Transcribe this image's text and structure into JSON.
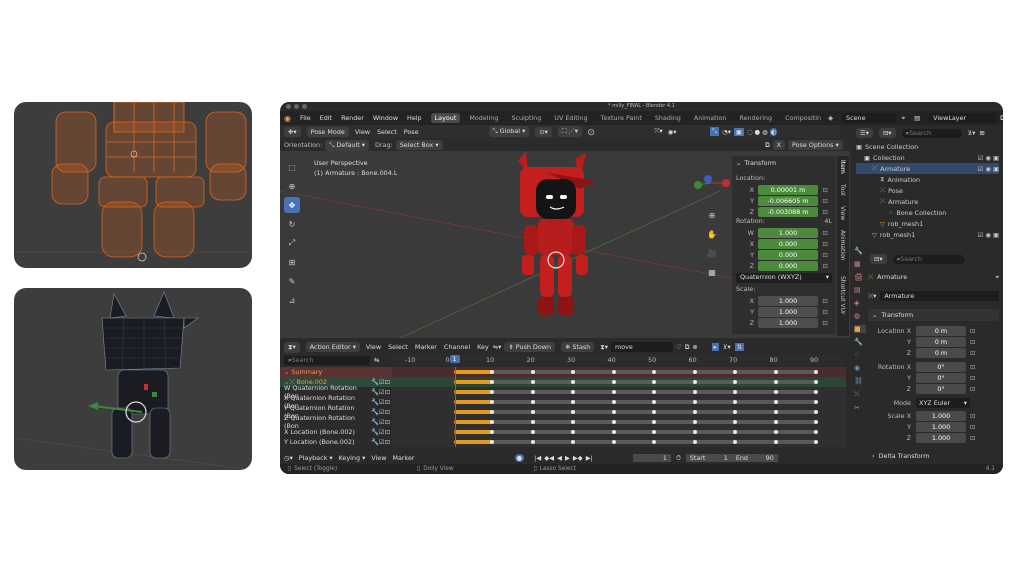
{
  "app": {
    "title": "* milly_FINAL - Blender 4.1",
    "menus": [
      "File",
      "Edit",
      "Render",
      "Window",
      "Help"
    ],
    "workspaces": [
      "Layout",
      "Modeling",
      "Sculpting",
      "UV Editing",
      "Texture Paint",
      "Shading",
      "Animation",
      "Rendering",
      "Compositin"
    ],
    "active_workspace": "Layout",
    "scene": "Scene",
    "view_layer": "ViewLayer"
  },
  "viewport_header": {
    "mode": "Pose Mode",
    "menus": [
      "View",
      "Select",
      "Pose"
    ],
    "transform_orientation": "Global",
    "orientation_label": "Orientation:",
    "orientation_value": "Default",
    "drag_label": "Drag:",
    "drag_value": "Select Box",
    "pose_options": "Pose Options",
    "x_toggle": "X"
  },
  "viewport": {
    "perspective": "User Perspective",
    "active": "(1) Armature : Bone.004.L"
  },
  "npanel": {
    "header": "Transform",
    "location_label": "Location:",
    "location": [
      [
        "X",
        "0.00001 m"
      ],
      [
        "Y",
        "-0.006605 m"
      ],
      [
        "Z",
        "-0.003088 m"
      ]
    ],
    "rotation_label": "Rotation:",
    "rotation_mode_short": "4L",
    "rotation": [
      [
        "W",
        "1.000"
      ],
      [
        "X",
        "0.000"
      ],
      [
        "Y",
        "0.000"
      ],
      [
        "Z",
        "0.000"
      ]
    ],
    "rotation_mode": "Quaternion (WXYZ)",
    "scale_label": "Scale:",
    "scale": [
      [
        "X",
        "1.000"
      ],
      [
        "Y",
        "1.000"
      ],
      [
        "Z",
        "1.000"
      ]
    ],
    "tabs": [
      "Item",
      "Tool",
      "View",
      "Animation",
      "Shortcut VUr"
    ]
  },
  "action_editor": {
    "mode": "Action Editor",
    "menus": [
      "View",
      "Select",
      "Marker",
      "Channel",
      "Key"
    ],
    "push_down": "Push Down",
    "stash": "Stash",
    "action_name": "move",
    "search_placeholder": "Search",
    "ruler": [
      "-10",
      "0",
      "10",
      "20",
      "30",
      "40",
      "50",
      "60",
      "70",
      "80",
      "90"
    ],
    "current_frame_marker": "1",
    "channels": [
      "Summary",
      "Bone.002",
      "W Quaternion Rotation (Bon",
      "X Quaternion Rotation (Bon",
      "Y Quaternion Rotation (Bon",
      "Z Quaternion Rotation (Bon",
      "X Location (Bone.002)",
      "Y Location (Bone.002)"
    ]
  },
  "playback_bar": {
    "playback": "Playback",
    "keying": "Keying",
    "view": "View",
    "marker": "Marker",
    "current_frame": "1",
    "start_label": "Start",
    "start": "1",
    "end_label": "End",
    "end": "90"
  },
  "status_bar": {
    "select": "Select (Toggle)",
    "dolly": "Dolly View",
    "lasso": "Lasso Select",
    "version": "4.1"
  },
  "outliner": {
    "search_placeholder": "Search",
    "items": [
      {
        "label": "Scene Collection",
        "indent": 0
      },
      {
        "label": "Collection",
        "indent": 1
      },
      {
        "label": "Armature",
        "indent": 2
      },
      {
        "label": "Animation",
        "indent": 3
      },
      {
        "label": "Pose",
        "indent": 3
      },
      {
        "label": "Armature",
        "indent": 3
      },
      {
        "label": "Bone Collection",
        "indent": 4
      },
      {
        "label": "rob_mesh1",
        "indent": 3
      },
      {
        "label": "rob_mesh1",
        "indent": 2
      }
    ]
  },
  "properties": {
    "search_placeholder": "Search",
    "object_name": "Armature",
    "data_name": "Armature",
    "transform_header": "Transform",
    "location_label": "Location X",
    "location": [
      [
        "",
        "0 m"
      ],
      [
        "Y",
        "0 m"
      ],
      [
        "Z",
        "0 m"
      ]
    ],
    "rotation_label": "Rotation X",
    "rotation": [
      [
        "",
        "0°"
      ],
      [
        "Y",
        "0°"
      ],
      [
        "Z",
        "0°"
      ]
    ],
    "mode_label": "Mode",
    "mode_value": "XYZ Euler",
    "scale_label": "Scale X",
    "scale": [
      [
        "",
        "1.000"
      ],
      [
        "Y",
        "1.000"
      ],
      [
        "Z",
        "1.000"
      ]
    ],
    "delta_transform": "Delta Transform"
  },
  "colors": {
    "accent": "#4772b3",
    "green_field": "#4d8a3d",
    "orange_key": "#e39a1f",
    "wire": "#e0641a"
  }
}
